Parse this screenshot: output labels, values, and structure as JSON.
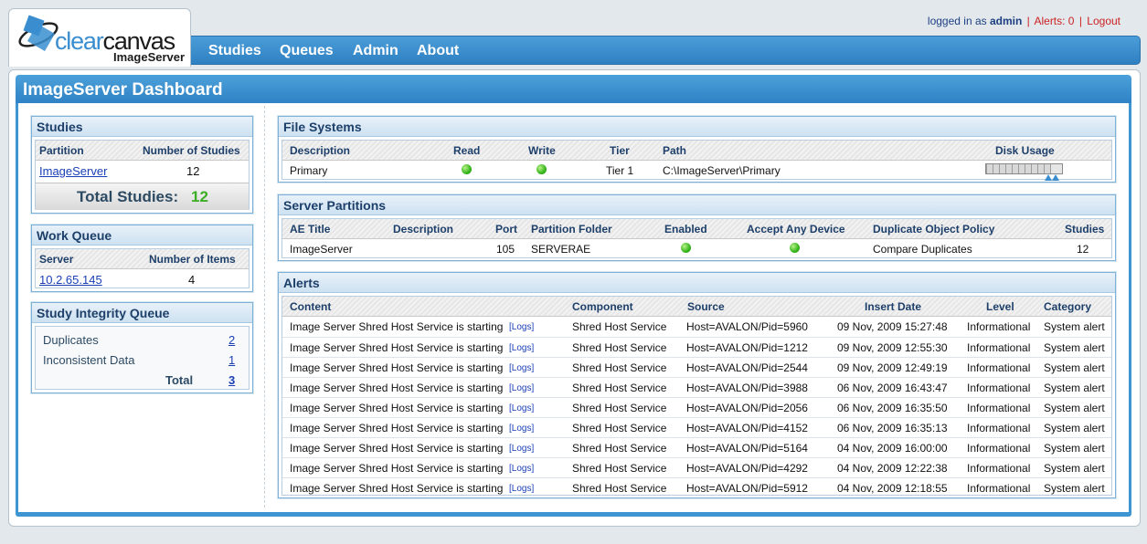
{
  "brand": {
    "name_part1": "clear",
    "name_part2": "canvas",
    "subtitle": "ImageServer"
  },
  "user_bar": {
    "logged_in_prefix": "logged in as",
    "username": "admin",
    "alerts": "Alerts: 0",
    "logout": "Logout"
  },
  "nav": [
    "Studies",
    "Queues",
    "Admin",
    "About"
  ],
  "page_title": "ImageServer Dashboard",
  "studies_panel": {
    "title": "Studies",
    "col_partition": "Partition",
    "col_count": "Number of Studies",
    "rows": [
      {
        "partition": "ImageServer",
        "count": "12"
      }
    ],
    "total_label": "Total Studies:",
    "total_value": "12"
  },
  "work_queue_panel": {
    "title": "Work Queue",
    "col_server": "Server",
    "col_items": "Number of Items",
    "rows": [
      {
        "server": "10.2.65.145",
        "items": "4"
      }
    ]
  },
  "integrity_panel": {
    "title": "Study Integrity Queue",
    "rows": [
      {
        "label": "Duplicates",
        "value": "2"
      },
      {
        "label": "Inconsistent Data",
        "value": "1"
      }
    ],
    "total_label": "Total",
    "total_value": "3"
  },
  "file_systems_panel": {
    "title": "File Systems",
    "columns": [
      "Description",
      "Read",
      "Write",
      "Tier",
      "Path",
      "Disk Usage"
    ],
    "rows": [
      {
        "description": "Primary",
        "read": true,
        "write": true,
        "tier": "Tier 1",
        "path": "C:\\ImageServer\\Primary",
        "disk_usage_fraction": 0.85
      }
    ]
  },
  "partitions_panel": {
    "title": "Server Partitions",
    "columns": [
      "AE Title",
      "Description",
      "Port",
      "Partition Folder",
      "Enabled",
      "Accept Any Device",
      "Duplicate Object Policy",
      "Studies"
    ],
    "rows": [
      {
        "ae_title": "ImageServer",
        "description": "",
        "port": "105",
        "folder": "SERVERAE",
        "enabled": true,
        "accept_any": true,
        "policy": "Compare Duplicates",
        "studies": "12"
      }
    ]
  },
  "alerts_panel": {
    "title": "Alerts",
    "columns": [
      "Content",
      "Component",
      "Source",
      "Insert Date",
      "Level",
      "Category"
    ],
    "logs_link": "[Logs]",
    "rows": [
      {
        "content": "Image Server Shred Host Service is starting",
        "component": "Shred Host Service",
        "source": "Host=AVALON/Pid=5960",
        "date": "09 Nov, 2009 15:27:48",
        "level": "Informational",
        "category": "System alert"
      },
      {
        "content": "Image Server Shred Host Service is starting",
        "component": "Shred Host Service",
        "source": "Host=AVALON/Pid=1212",
        "date": "09 Nov, 2009 12:55:30",
        "level": "Informational",
        "category": "System alert"
      },
      {
        "content": "Image Server Shred Host Service is starting",
        "component": "Shred Host Service",
        "source": "Host=AVALON/Pid=2544",
        "date": "09 Nov, 2009 12:49:19",
        "level": "Informational",
        "category": "System alert"
      },
      {
        "content": "Image Server Shred Host Service is starting",
        "component": "Shred Host Service",
        "source": "Host=AVALON/Pid=3988",
        "date": "06 Nov, 2009 16:43:47",
        "level": "Informational",
        "category": "System alert"
      },
      {
        "content": "Image Server Shred Host Service is starting",
        "component": "Shred Host Service",
        "source": "Host=AVALON/Pid=2056",
        "date": "06 Nov, 2009 16:35:50",
        "level": "Informational",
        "category": "System alert"
      },
      {
        "content": "Image Server Shred Host Service is starting",
        "component": "Shred Host Service",
        "source": "Host=AVALON/Pid=4152",
        "date": "06 Nov, 2009 16:35:13",
        "level": "Informational",
        "category": "System alert"
      },
      {
        "content": "Image Server Shred Host Service is starting",
        "component": "Shred Host Service",
        "source": "Host=AVALON/Pid=5164",
        "date": "04 Nov, 2009 16:00:00",
        "level": "Informational",
        "category": "System alert"
      },
      {
        "content": "Image Server Shred Host Service is starting",
        "component": "Shred Host Service",
        "source": "Host=AVALON/Pid=4292",
        "date": "04 Nov, 2009 12:22:38",
        "level": "Informational",
        "category": "System alert"
      },
      {
        "content": "Image Server Shred Host Service is starting",
        "component": "Shred Host Service",
        "source": "Host=AVALON/Pid=5912",
        "date": "04 Nov, 2009 12:18:55",
        "level": "Informational",
        "category": "System alert"
      }
    ]
  },
  "colors": {
    "accent": "#2f82c4",
    "status_ok": "#33b51a",
    "total_green": "#3cae23"
  }
}
